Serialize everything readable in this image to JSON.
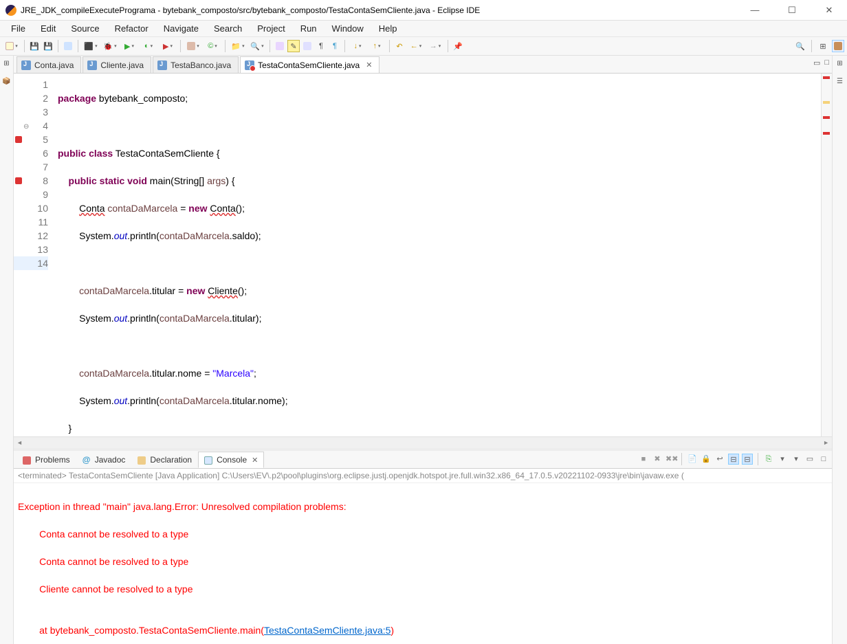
{
  "window": {
    "title": "JRE_JDK_compileExecutePrograma - bytebank_composto/src/bytebank_composto/TestaContaSemCliente.java - Eclipse IDE"
  },
  "menu": {
    "file": "File",
    "edit": "Edit",
    "source": "Source",
    "refactor": "Refactor",
    "navigate": "Navigate",
    "search": "Search",
    "project": "Project",
    "run": "Run",
    "window": "Window",
    "help": "Help"
  },
  "editor_tabs": {
    "t0": "Conta.java",
    "t1": "Cliente.java",
    "t2": "TestaBanco.java",
    "t3": "TestaContaSemCliente.java"
  },
  "code": {
    "l1_pkg": "package",
    "l1_name": " bytebank_composto;",
    "l3_a": "public",
    "l3_b": " class",
    "l3_c": " TestaContaSemCliente {",
    "l4_a": "    public",
    "l4_b": " static",
    "l4_c": " void",
    "l4_d": " main(String[] ",
    "l4_arg": "args",
    "l4_e": ") {",
    "l5_a": "        ",
    "l5_type": "Conta",
    "l5_sp": " ",
    "l5_var": "contaDaMarcela",
    "l5_eq": " = ",
    "l5_new": "new",
    "l5_sp2": " ",
    "l5_ctor": "Conta",
    "l5_end": "();",
    "l6_a": "        System.",
    "l6_out": "out",
    "l6_b": ".println(",
    "l6_var": "contaDaMarcela",
    "l6_c": ".saldo);",
    "l8_a": "        ",
    "l8_var": "contaDaMarcela",
    "l8_b": ".titular = ",
    "l8_new": "new",
    "l8_sp": " ",
    "l8_ctor": "Cliente",
    "l8_end": "();",
    "l9_a": "        System.",
    "l9_out": "out",
    "l9_b": ".println(",
    "l9_var": "contaDaMarcela",
    "l9_c": ".titular);",
    "l11_a": "        ",
    "l11_var": "contaDaMarcela",
    "l11_b": ".titular.nome = ",
    "l11_str": "\"Marcela\"",
    "l11_c": ";",
    "l12_a": "        System.",
    "l12_out": "out",
    "l12_b": ".println(",
    "l12_var": "contaDaMarcela",
    "l12_c": ".titular.nome);",
    "l13": "    }",
    "l14": "}"
  },
  "line_numbers": {
    "n1": "1",
    "n2": "2",
    "n3": "3",
    "n4": "4",
    "n5": "5",
    "n6": "6",
    "n7": "7",
    "n8": "8",
    "n9": "9",
    "n10": "10",
    "n11": "11",
    "n12": "12",
    "n13": "13",
    "n14": "14"
  },
  "bottom_tabs": {
    "problems": "Problems",
    "javadoc": "Javadoc",
    "declaration": "Declaration",
    "console": "Console"
  },
  "process_line": "<terminated> TestaContaSemCliente [Java Application] C:\\Users\\EV\\.p2\\pool\\plugins\\org.eclipse.justj.openjdk.hotspot.jre.full.win32.x86_64_17.0.5.v20221102-0933\\jre\\bin\\javaw.exe  (",
  "console": {
    "l1": "Exception in thread \"main\" java.lang.Error: Unresolved compilation problems: ",
    "l2": "\tConta cannot be resolved to a type",
    "l3": "\tConta cannot be resolved to a type",
    "l4": "\tCliente cannot be resolved to a type",
    "l5": "",
    "l6a": "\tat bytebank_composto.TestaContaSemCliente.main(",
    "l6link": "TestaContaSemCliente.java:5",
    "l6b": ")"
  }
}
